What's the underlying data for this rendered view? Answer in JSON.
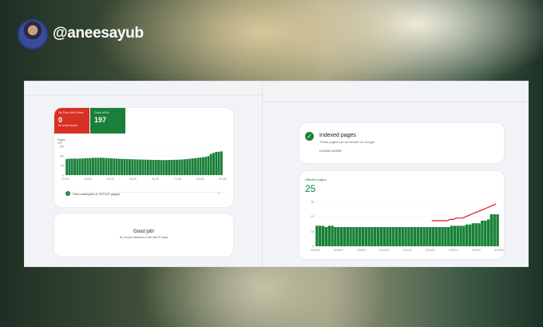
{
  "header": {
    "handle": "@aneesayub"
  },
  "left": {
    "tiles": [
      {
        "label": "No Core Web Vitals",
        "value": "0",
        "sub": "No critical issues",
        "color": "#d93025"
      },
      {
        "label": "Good URLs",
        "value": "197",
        "sub": "",
        "color": "#188038"
      }
    ],
    "chart": {
      "ylabel": "Pages",
      "ytop": "197",
      "yticks": [
        "150",
        "100",
        "50",
        "0"
      ],
      "xticks": [
        "2/9/25",
        "3/1/25",
        "4/1/25",
        "5/1/25",
        "6/1/25",
        "7/1/25",
        "8/1/25",
        "9/1/25"
      ]
    },
    "link": "View examples of 197/197 pages",
    "good_title": "Good job!",
    "good_sub": "No issues detected in the last 90 days"
  },
  "right": {
    "indexed_title": "Indexed pages",
    "indexed_sub": "These pages can be served on Google",
    "learn_more": "LEARN MORE",
    "affected_label": "Affected pages",
    "affected_value": "25",
    "yticks": [
      "30",
      "20",
      "10",
      "0"
    ],
    "xticks": [
      "8/26/24",
      "9/16/24",
      "9/30/24",
      "10/12/24",
      "11/2/24",
      "11/23/24",
      "12/3/24",
      "1/22/25",
      "8/19/25"
    ]
  },
  "chart_data": [
    {
      "type": "bar",
      "title": "Pages",
      "values": [
        110,
        112,
        113,
        113,
        112,
        113,
        114,
        115,
        116,
        117,
        118,
        118,
        119,
        119,
        118,
        117,
        116,
        115,
        114,
        113,
        112,
        111,
        110,
        110,
        109,
        108,
        108,
        107,
        107,
        106,
        106,
        105,
        105,
        104,
        104,
        104,
        103,
        103,
        103,
        104,
        104,
        105,
        105,
        106,
        107,
        108,
        110,
        112,
        114,
        116,
        118,
        120,
        122,
        125,
        130,
        145,
        152,
        158,
        160,
        162
      ],
      "ylim": [
        0,
        197
      ],
      "color": "#188038"
    },
    {
      "type": "bar",
      "title": "Affected pages",
      "values": [
        16,
        16,
        16,
        15,
        16,
        16,
        15,
        15,
        15,
        15,
        15,
        15,
        15,
        15,
        15,
        15,
        15,
        15,
        15,
        15,
        15,
        15,
        15,
        15,
        15,
        15,
        15,
        15,
        15,
        15,
        15,
        15,
        15,
        15,
        15,
        15,
        15,
        15,
        15,
        15,
        15,
        15,
        15,
        15,
        16,
        16,
        16,
        16,
        16,
        17,
        17,
        18,
        18,
        18,
        20,
        20,
        21,
        25,
        25,
        25
      ],
      "ylim": [
        0,
        35
      ],
      "color": "#188038",
      "annotation_line": [
        0,
        0,
        0,
        0,
        0,
        0,
        0,
        0,
        0,
        0,
        0,
        0,
        0,
        0,
        0,
        0,
        0,
        0,
        0,
        0,
        0,
        0,
        0,
        0,
        0,
        0,
        0,
        0,
        0,
        0,
        20,
        20,
        20,
        20,
        20,
        20,
        21,
        21,
        22,
        22,
        22,
        23,
        24,
        25,
        26,
        27,
        28,
        29,
        30,
        31,
        32,
        33
      ]
    }
  ]
}
